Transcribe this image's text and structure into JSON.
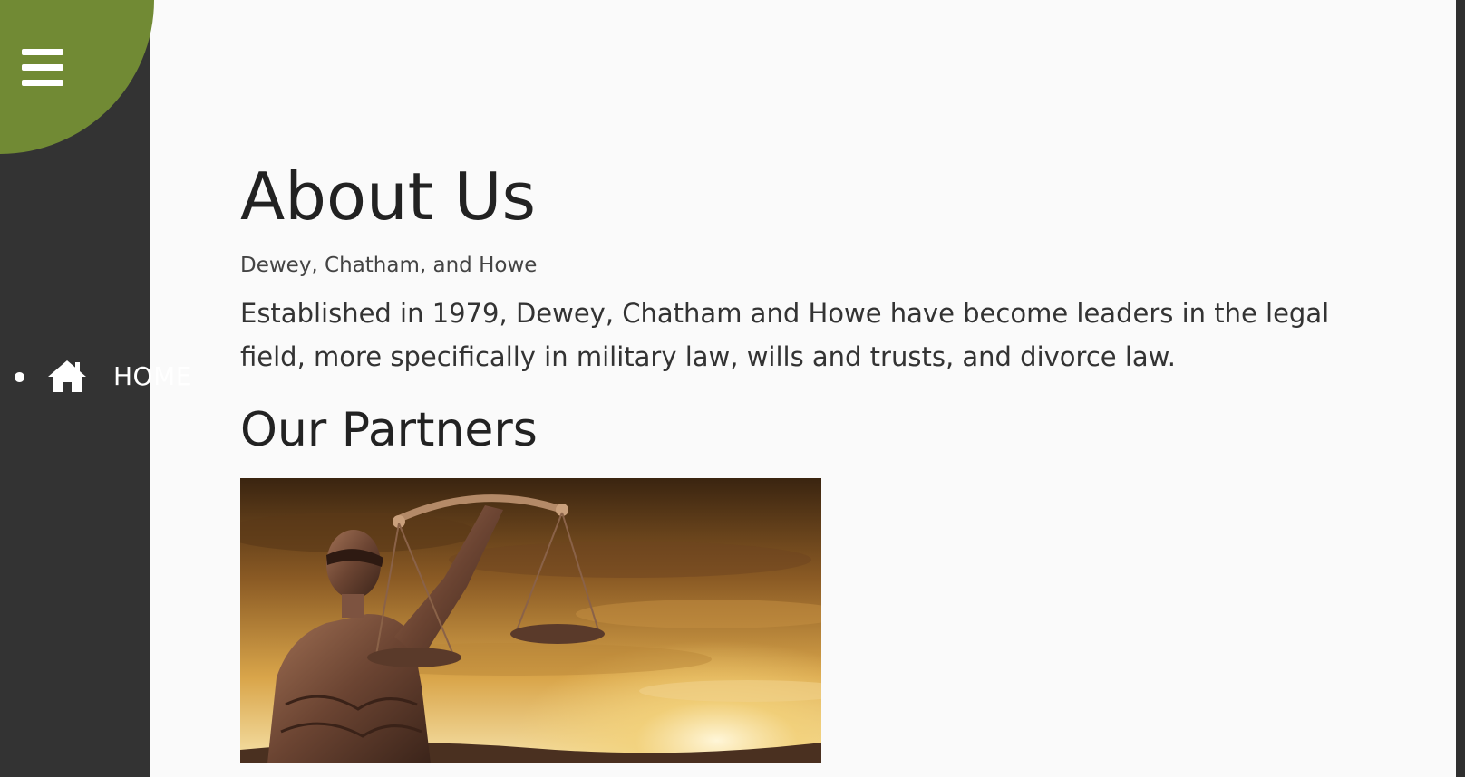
{
  "sidebar": {
    "menu_icon": "hamburger-menu-icon",
    "accent_color": "#718a34",
    "background_color": "#333333",
    "nav_items": [
      {
        "icon": "home-icon",
        "label": "HOME"
      }
    ]
  },
  "main": {
    "title": "About Us",
    "subtitle": "Dewey, Chatham, and Howe",
    "intro": "Established in 1979, Dewey, Chatham and Howe have become leaders in the legal field, more specifically in military law, wills and trusts, and divorce law.",
    "section_title": "Our Partners",
    "image": "lady-justice-scales-image"
  }
}
